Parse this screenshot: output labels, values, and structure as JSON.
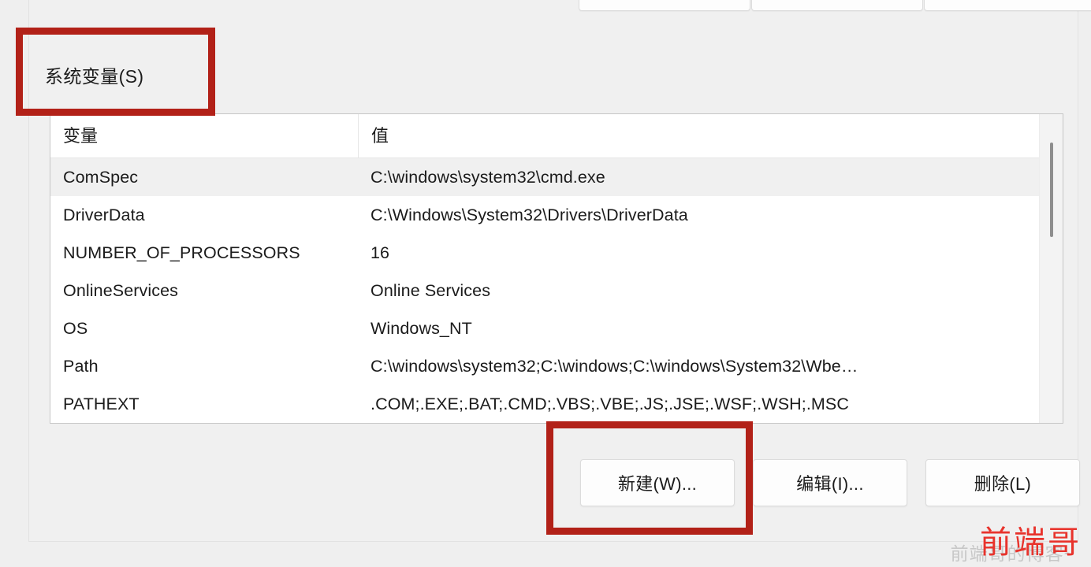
{
  "dialog": {
    "section_label": "系统变量(S)"
  },
  "top_partial_buttons": [
    {
      "name": "user-new-button"
    },
    {
      "name": "user-edit-button"
    },
    {
      "name": "user-delete-button"
    }
  ],
  "table": {
    "columns": [
      "变量",
      "值"
    ],
    "rows": [
      {
        "variable": "ComSpec",
        "value": "C:\\windows\\system32\\cmd.exe",
        "selected": true
      },
      {
        "variable": "DriverData",
        "value": "C:\\Windows\\System32\\Drivers\\DriverData",
        "selected": false
      },
      {
        "variable": "NUMBER_OF_PROCESSORS",
        "value": "16",
        "selected": false
      },
      {
        "variable": "OnlineServices",
        "value": "Online Services",
        "selected": false
      },
      {
        "variable": "OS",
        "value": "Windows_NT",
        "selected": false
      },
      {
        "variable": "Path",
        "value": "C:\\windows\\system32;C:\\windows;C:\\windows\\System32\\Wbe…",
        "selected": false
      },
      {
        "variable": "PATHEXT",
        "value": ".COM;.EXE;.BAT;.CMD;.VBS;.VBE;.JS;.JSE;.WSF;.WSH;.MSC",
        "selected": false
      }
    ]
  },
  "buttons": {
    "new": "新建(W)...",
    "edit": "编辑(I)...",
    "delete": "删除(L)"
  },
  "annotations": {
    "color": "#b22118",
    "boxes": [
      "系统变量(S)",
      "新建(W)..."
    ]
  },
  "watermark": {
    "main": "前端哥",
    "sub": "前端哥的博客~"
  }
}
